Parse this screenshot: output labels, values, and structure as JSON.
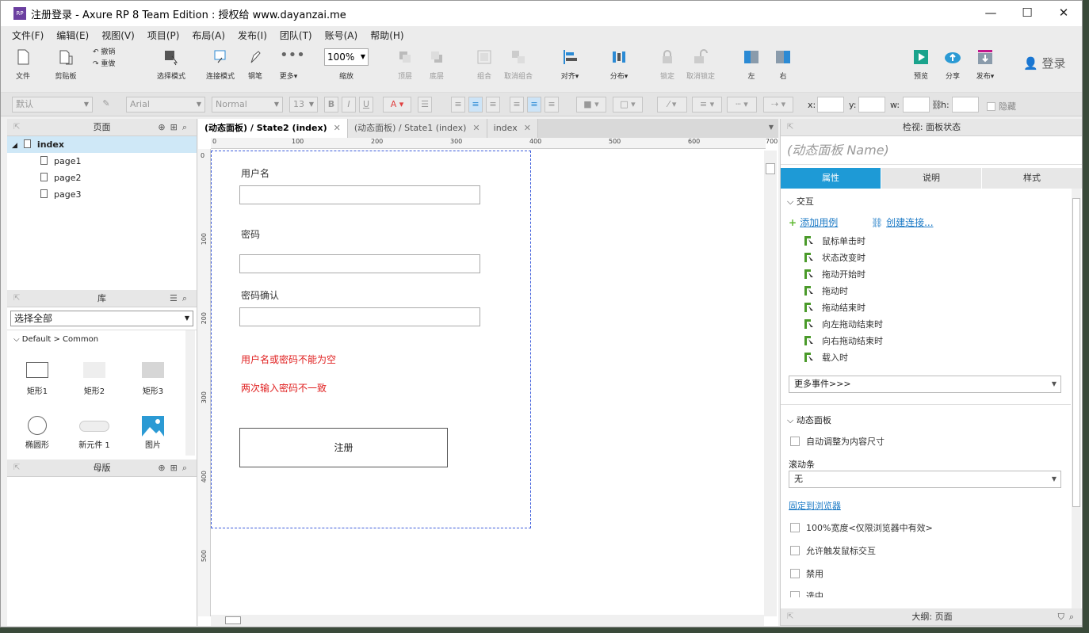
{
  "window": {
    "title": "注册登录 - Axure RP 8 Team Edition : 授权给 www.dayanzai.me",
    "app_icon": "RP"
  },
  "menu": [
    "文件(F)",
    "编辑(E)",
    "视图(V)",
    "项目(P)",
    "布局(A)",
    "发布(I)",
    "团队(T)",
    "账号(A)",
    "帮助(H)"
  ],
  "toolbar": {
    "file": "文件",
    "clipboard": "剪贴板",
    "undo": "撤销",
    "redo": "重做",
    "select_mode": "选择模式",
    "connect_mode": "连接模式",
    "pen": "钢笔",
    "more": "更多▾",
    "zoom_value": "100%",
    "zoom": "缩放",
    "top": "顶层",
    "bottom": "底层",
    "group": "组合",
    "ungroup": "取消组合",
    "align": "对齐▾",
    "distribute": "分布▾",
    "lock": "锁定",
    "unlock": "取消锁定",
    "left": "左",
    "right": "右",
    "preview": "预览",
    "share": "分享",
    "publish": "发布▾",
    "login": "登录"
  },
  "format": {
    "style": "默认",
    "font": "Arial",
    "weight": "Normal",
    "size": "13",
    "x_label": "x:",
    "y_label": "y:",
    "w_label": "w:",
    "h_label": "h:",
    "hide": "隐藏"
  },
  "pages_panel": {
    "title": "页面",
    "root": "index",
    "children": [
      "page1",
      "page2",
      "page3"
    ]
  },
  "library_panel": {
    "title": "库",
    "select": "选择全部",
    "group": "Default > Common",
    "items": [
      "矩形1",
      "矩形2",
      "矩形3",
      "椭圆形",
      "新元件 1",
      "图片"
    ]
  },
  "masters_panel": {
    "title": "母版"
  },
  "tabs": [
    "(动态面板) / State2 (index)",
    "(动态面板) / State1 (index)",
    "index"
  ],
  "ruler": {
    "h": [
      "0",
      "100",
      "200",
      "300",
      "400",
      "500",
      "600",
      "700"
    ],
    "v": [
      "0",
      "100",
      "200",
      "300",
      "400",
      "500"
    ]
  },
  "design": {
    "username_label": "用户名",
    "password_label": "密码",
    "confirm_label": "密码确认",
    "error1": "用户名或密码不能为空",
    "error2": "两次输入密码不一致",
    "register_button": "注册"
  },
  "inspector": {
    "header": "检视: 面板状态",
    "name_placeholder": "(动态面板 Name)",
    "tabs": [
      "属性",
      "说明",
      "样式"
    ],
    "interaction": "交互",
    "add_case": "添加用例",
    "create_link": "创建连接...",
    "events": [
      "鼠标单击时",
      "状态改变时",
      "拖动开始时",
      "拖动时",
      "拖动结束时",
      "向左拖动结束时",
      "向右拖动结束时",
      "载入时"
    ],
    "more_events": "更多事件>>>",
    "dynamic_panel": "动态面板",
    "auto_fit": "自动调整为内容尺寸",
    "scrollbar": "滚动条",
    "scrollbar_value": "无",
    "pin": "固定到浏览器",
    "full_width": "100%宽度<仅限浏览器中有效>",
    "allow_mouse": "允许触发鼠标交互",
    "disabled": "禁用",
    "selected": "选中",
    "outline": "大纲: 页面"
  }
}
